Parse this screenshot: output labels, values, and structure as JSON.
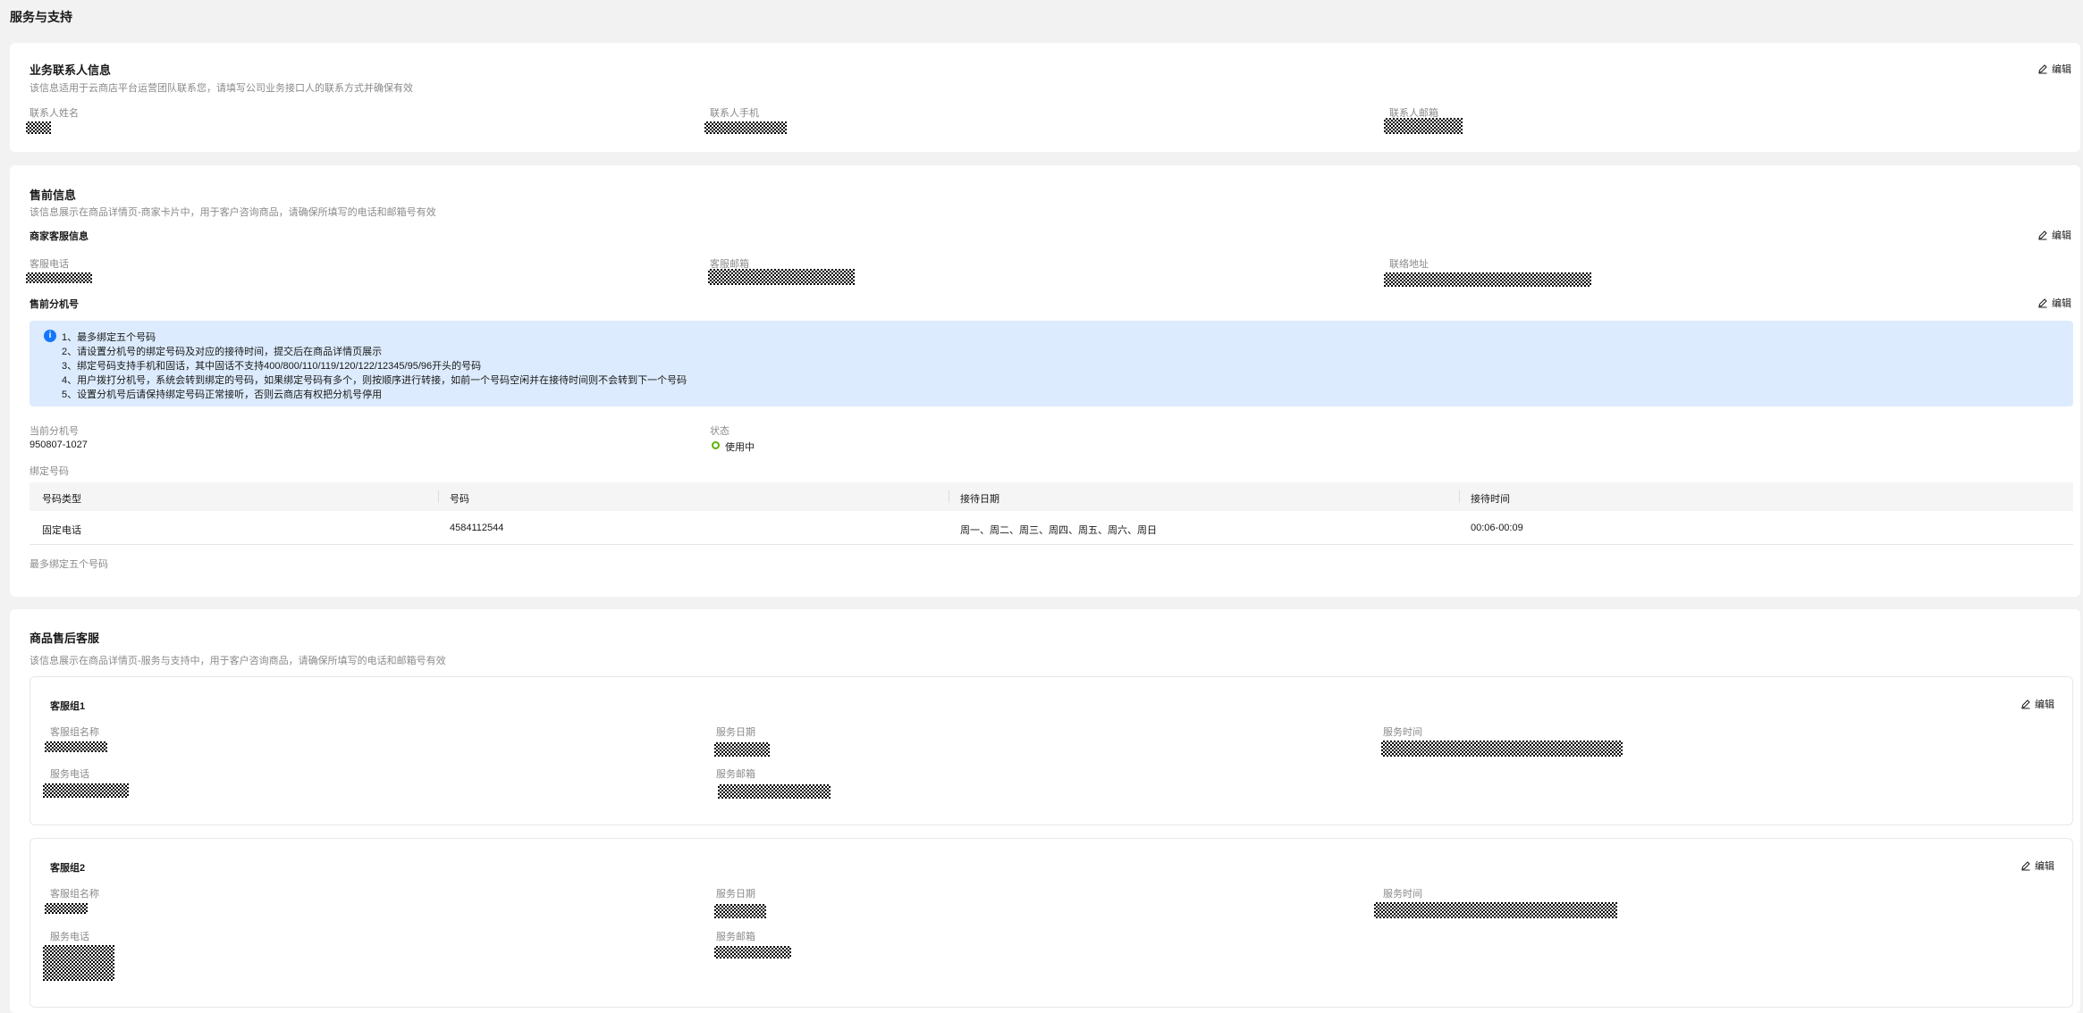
{
  "page_title": "服务与支持",
  "edit_label": "编辑",
  "contact": {
    "title": "业务联系人信息",
    "desc": "该信息适用于云商店平台运营团队联系您，请填写公司业务接口人的联系方式并确保有效",
    "name_label": "联系人姓名",
    "phone_label": "联系人手机",
    "email_label": "联系人邮箱"
  },
  "presale": {
    "title": "售前信息",
    "desc": "该信息展示在商品详情页-商家卡片中，用于客户咨询商品，请确保所填写的电话和邮箱号有效",
    "merchant_title": "商家客服信息",
    "cs_phone_label": "客服电话",
    "cs_email_label": "客服邮箱",
    "address_label": "联络地址",
    "ext_title": "售前分机号",
    "notice": [
      "1、最多绑定五个号码",
      "2、请设置分机号的绑定号码及对应的接待时间，提交后在商品详情页展示",
      "3、绑定号码支持手机和固话，其中固话不支持400/800/110/119/120/122/12345/95/96开头的号码",
      "4、用户拨打分机号，系统会转到绑定的号码，如果绑定号码有多个，则按顺序进行转接，如前一个号码空闲并在接待时间则不会转到下一个号码",
      "5、设置分机号后请保持绑定号码正常接听，否则云商店有权把分机号停用"
    ],
    "current_ext_label": "当前分机号",
    "current_ext_value": "950807-1027",
    "status_label": "状态",
    "status_value": "使用中",
    "status_color": "#5cb300",
    "bound_label": "绑定号码",
    "table": {
      "headers": [
        "号码类型",
        "号码",
        "接待日期",
        "接待时间"
      ],
      "rows": [
        [
          "固定电话",
          "4584112544",
          "周一、周二、周三、周四、周五、周六、周日",
          "00:06-00:09"
        ]
      ]
    },
    "table_footnote": "最多绑定五个号码"
  },
  "aftersale": {
    "title": "商品售后客服",
    "desc": "该信息展示在商品详情页-服务与支持中，用于客户咨询商品，请确保所填写的电话和邮箱号有效",
    "groups": [
      {
        "title": "客服组1",
        "name_label": "客服组名称",
        "date_label": "服务日期",
        "time_label": "服务时间",
        "phone_label": "服务电话",
        "email_label": "服务邮箱"
      },
      {
        "title": "客服组2",
        "name_label": "客服组名称",
        "date_label": "服务日期",
        "time_label": "服务时间",
        "phone_label": "服务电话",
        "email_label": "服务邮箱"
      }
    ]
  }
}
